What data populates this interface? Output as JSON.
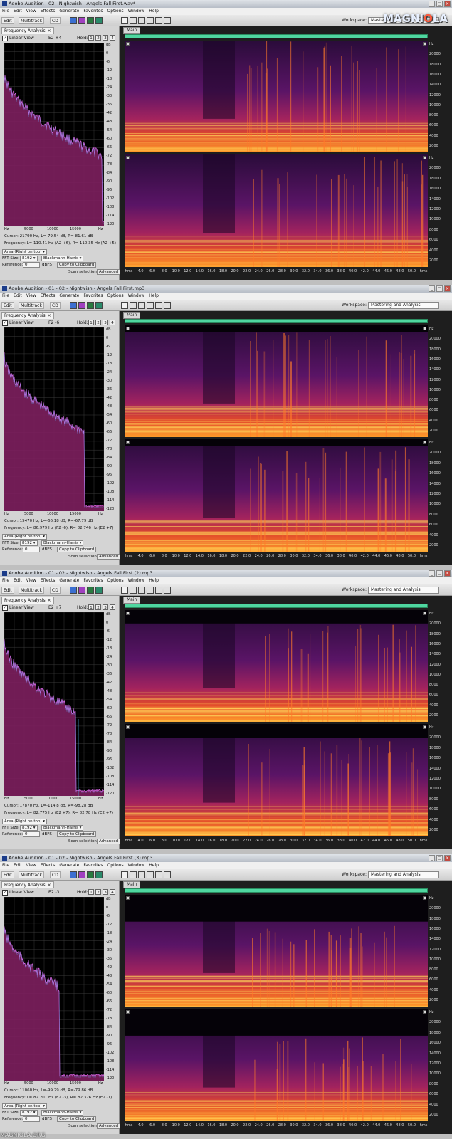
{
  "watermark": {
    "text_a": "MAGNI",
    "text_o": "O",
    "text_b": "LA"
  },
  "footer_watermark": "MAGNIOLA.ORG",
  "common": {
    "menus": [
      "File",
      "Edit",
      "View",
      "Effects",
      "Generate",
      "Favorites",
      "Options",
      "Window",
      "Help"
    ],
    "toolbar": {
      "edit": "Edit",
      "multitrack": "Multitrack",
      "cd": "CD"
    },
    "workspace_label": "Workspace:",
    "workspace_value": "Mastering and Analysis",
    "panel_tab": "Frequency Analysis",
    "panel_tab_close": "×",
    "linear_view": "Linear View",
    "hold_label": "Hold:",
    "hold_buttons": [
      "1",
      "2",
      "3",
      "4"
    ],
    "db_ticks": [
      "dB",
      "0",
      "-6",
      "-12",
      "-18",
      "-24",
      "-30",
      "-36",
      "-42",
      "-48",
      "-54",
      "-60",
      "-66",
      "-72",
      "-78",
      "-84",
      "-90",
      "-96",
      "-102",
      "-108",
      "-114",
      "-120"
    ],
    "hz_ticks": [
      "Hz",
      "5000",
      "10000",
      "15000",
      "Hz"
    ],
    "area_select": "Area (Right on top)",
    "fft_label": "FFT Size:",
    "fft_value": "8192",
    "window_value": "Blackmann-Harris",
    "reference_label": "Reference:",
    "reference_value": "0",
    "dbfs_label": "dBFS",
    "copy_button": "Copy to Clipboard",
    "scan_label": "Scan selection",
    "advanced_button": "Advanced",
    "main_tab": "Main",
    "spec_hz_ticks": [
      "Hz",
      "20000",
      "18000",
      "16000",
      "14000",
      "12000",
      "10000",
      "8000",
      "6000",
      "4000",
      "2000"
    ],
    "time_ticks": [
      "hms",
      "4.0",
      "6.0",
      "8.0",
      "10.0",
      "12.0",
      "14.0",
      "16.0",
      "18.0",
      "20.0",
      "22.0",
      "24.0",
      "26.0",
      "28.0",
      "30.0",
      "32.0",
      "34.0",
      "36.0",
      "38.0",
      "40.0",
      "42.0",
      "44.0",
      "46.0",
      "48.0",
      "50.0",
      "hms"
    ]
  },
  "windows": [
    {
      "title": "Adobe Audition - 02 - Nightwish - Angels Fall First.wav*",
      "note": "E2 +4",
      "cursor": "Cursor: 21790 Hz, L=-79.54 dB, R=-81.61 dB",
      "frequency": "Frequency: L= 110.41 Hz (A2 +6), R= 110.35 Hz (A2 +5)",
      "cutoff": 0.98,
      "spike": false,
      "black_top": 0.0,
      "show_watermark": true
    },
    {
      "title": "Adobe Audition - 01 - 02 - Nightwish - Angels Fall First.mp3",
      "note": "F2 -6",
      "cursor": "Cursor: 15470 Hz, L=-66.18 dB, R=-67.79 dB",
      "frequency": "Frequency: L= 86.979 Hz (F2 -6), R= 82.746 Hz (E2 +7)",
      "cutoff": 0.8,
      "spike": false,
      "black_top": 0.06,
      "show_watermark": false
    },
    {
      "title": "Adobe Audition - 01 - 02 - Nightwish - Angels Fall First (2).mp3",
      "note": "E2 +7",
      "cursor": "Cursor: 17870 Hz, L=-114.8 dB, R=-98.28 dB",
      "frequency": "Frequency: L= 82.775 Hz (E2 +7), R= 82.78 Hz (E2 +7)",
      "cutoff": 0.72,
      "spike": true,
      "black_top": 0.12,
      "show_watermark": false
    },
    {
      "title": "Adobe Audition - 01 - 02 - Nightwish - Angels Fall First (3).mp3",
      "note": "E2 -3",
      "cursor": "Cursor: 11060 Hz, L=-99.29 dB, R=-79.86 dB",
      "frequency": "Frequency: L= 82.201 Hz (E2 -3), R= 82.326 Hz (E2 -1)",
      "cutoff": 0.55,
      "spike": false,
      "black_top": 0.24,
      "show_watermark": false
    }
  ]
}
